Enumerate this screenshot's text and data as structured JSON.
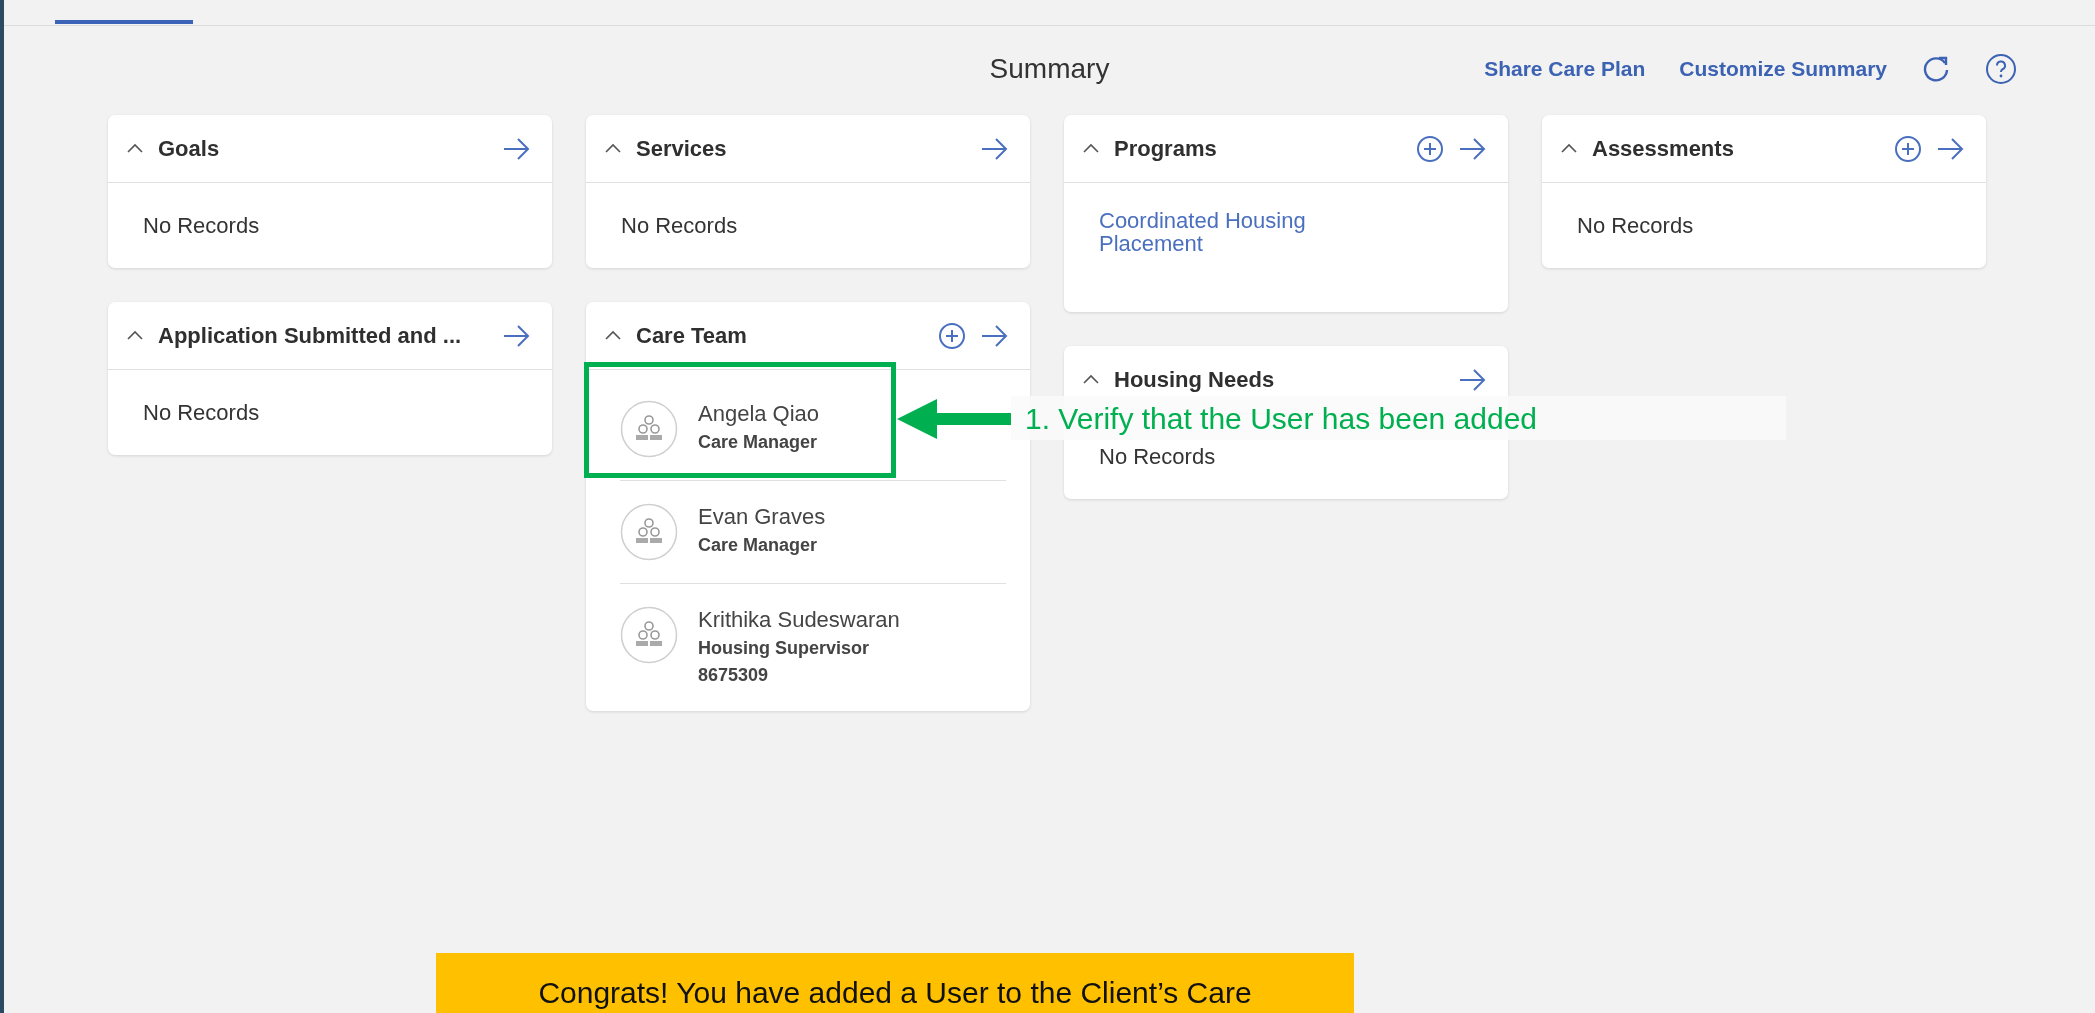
{
  "header": {
    "title": "Summary",
    "links": [
      "Share Care Plan",
      "Customize Summary"
    ]
  },
  "card_columns": [
    {
      "cards": [
        {
          "title": "Goals",
          "expanded": true,
          "add_button": false,
          "kind": "empty",
          "empty_text": "No Records"
        },
        {
          "title": "Application Submitted and ...",
          "expanded": true,
          "add_button": false,
          "kind": "empty",
          "empty_text": "No Records"
        }
      ]
    },
    {
      "cards": [
        {
          "title": "Services",
          "expanded": true,
          "add_button": false,
          "kind": "empty",
          "empty_text": "No Records"
        },
        {
          "title": "Care Team",
          "expanded": true,
          "add_button": true,
          "kind": "people",
          "members": [
            {
              "name": "Angela Qiao",
              "role": "Care Manager"
            },
            {
              "name": "Evan Graves",
              "role": "Care Manager"
            },
            {
              "name": "Krithika Sudeswaran",
              "role": "Housing Supervisor",
              "phone": "8675309"
            }
          ]
        }
      ]
    },
    {
      "cards": [
        {
          "title": "Programs",
          "expanded": true,
          "add_button": true,
          "kind": "links",
          "links": [
            "Coordinated Housing Placement"
          ]
        },
        {
          "title": "Housing Needs",
          "expanded": true,
          "add_button": false,
          "kind": "empty",
          "empty_text": "No Records"
        }
      ]
    },
    {
      "cards": [
        {
          "title": "Assessments",
          "expanded": true,
          "add_button": true,
          "kind": "empty",
          "empty_text": "No Records"
        }
      ]
    }
  ],
  "annotation": {
    "text": "1. Verify that the User has been added"
  },
  "banner": {
    "text": "Congrats! You have added a User to the Client’s Care"
  }
}
